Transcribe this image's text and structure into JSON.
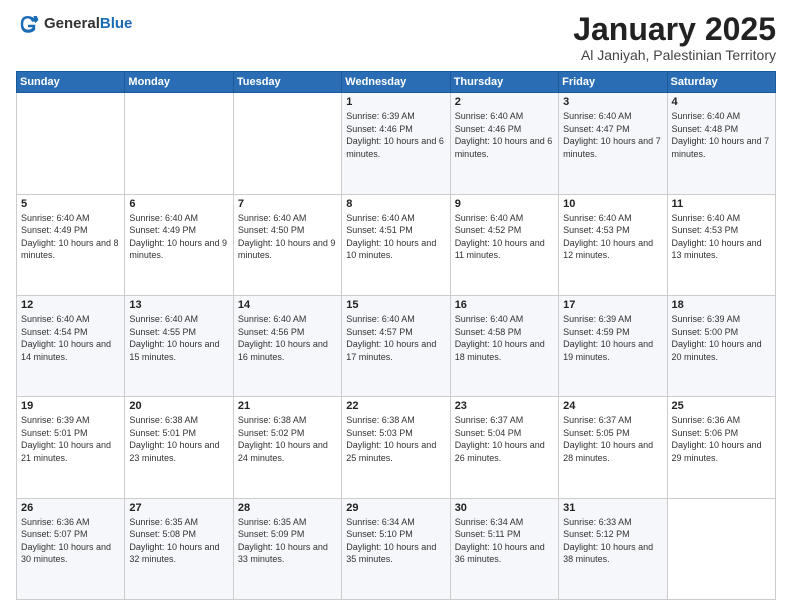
{
  "header": {
    "logo_general": "General",
    "logo_blue": "Blue",
    "title": "January 2025",
    "subtitle": "Al Janiyah, Palestinian Territory"
  },
  "weekdays": [
    "Sunday",
    "Monday",
    "Tuesday",
    "Wednesday",
    "Thursday",
    "Friday",
    "Saturday"
  ],
  "weeks": [
    [
      {
        "day": "",
        "sunrise": "",
        "sunset": "",
        "daylight": ""
      },
      {
        "day": "",
        "sunrise": "",
        "sunset": "",
        "daylight": ""
      },
      {
        "day": "",
        "sunrise": "",
        "sunset": "",
        "daylight": ""
      },
      {
        "day": "1",
        "sunrise": "Sunrise: 6:39 AM",
        "sunset": "Sunset: 4:46 PM",
        "daylight": "Daylight: 10 hours and 6 minutes."
      },
      {
        "day": "2",
        "sunrise": "Sunrise: 6:40 AM",
        "sunset": "Sunset: 4:46 PM",
        "daylight": "Daylight: 10 hours and 6 minutes."
      },
      {
        "day": "3",
        "sunrise": "Sunrise: 6:40 AM",
        "sunset": "Sunset: 4:47 PM",
        "daylight": "Daylight: 10 hours and 7 minutes."
      },
      {
        "day": "4",
        "sunrise": "Sunrise: 6:40 AM",
        "sunset": "Sunset: 4:48 PM",
        "daylight": "Daylight: 10 hours and 7 minutes."
      }
    ],
    [
      {
        "day": "5",
        "sunrise": "Sunrise: 6:40 AM",
        "sunset": "Sunset: 4:49 PM",
        "daylight": "Daylight: 10 hours and 8 minutes."
      },
      {
        "day": "6",
        "sunrise": "Sunrise: 6:40 AM",
        "sunset": "Sunset: 4:49 PM",
        "daylight": "Daylight: 10 hours and 9 minutes."
      },
      {
        "day": "7",
        "sunrise": "Sunrise: 6:40 AM",
        "sunset": "Sunset: 4:50 PM",
        "daylight": "Daylight: 10 hours and 9 minutes."
      },
      {
        "day": "8",
        "sunrise": "Sunrise: 6:40 AM",
        "sunset": "Sunset: 4:51 PM",
        "daylight": "Daylight: 10 hours and 10 minutes."
      },
      {
        "day": "9",
        "sunrise": "Sunrise: 6:40 AM",
        "sunset": "Sunset: 4:52 PM",
        "daylight": "Daylight: 10 hours and 11 minutes."
      },
      {
        "day": "10",
        "sunrise": "Sunrise: 6:40 AM",
        "sunset": "Sunset: 4:53 PM",
        "daylight": "Daylight: 10 hours and 12 minutes."
      },
      {
        "day": "11",
        "sunrise": "Sunrise: 6:40 AM",
        "sunset": "Sunset: 4:53 PM",
        "daylight": "Daylight: 10 hours and 13 minutes."
      }
    ],
    [
      {
        "day": "12",
        "sunrise": "Sunrise: 6:40 AM",
        "sunset": "Sunset: 4:54 PM",
        "daylight": "Daylight: 10 hours and 14 minutes."
      },
      {
        "day": "13",
        "sunrise": "Sunrise: 6:40 AM",
        "sunset": "Sunset: 4:55 PM",
        "daylight": "Daylight: 10 hours and 15 minutes."
      },
      {
        "day": "14",
        "sunrise": "Sunrise: 6:40 AM",
        "sunset": "Sunset: 4:56 PM",
        "daylight": "Daylight: 10 hours and 16 minutes."
      },
      {
        "day": "15",
        "sunrise": "Sunrise: 6:40 AM",
        "sunset": "Sunset: 4:57 PM",
        "daylight": "Daylight: 10 hours and 17 minutes."
      },
      {
        "day": "16",
        "sunrise": "Sunrise: 6:40 AM",
        "sunset": "Sunset: 4:58 PM",
        "daylight": "Daylight: 10 hours and 18 minutes."
      },
      {
        "day": "17",
        "sunrise": "Sunrise: 6:39 AM",
        "sunset": "Sunset: 4:59 PM",
        "daylight": "Daylight: 10 hours and 19 minutes."
      },
      {
        "day": "18",
        "sunrise": "Sunrise: 6:39 AM",
        "sunset": "Sunset: 5:00 PM",
        "daylight": "Daylight: 10 hours and 20 minutes."
      }
    ],
    [
      {
        "day": "19",
        "sunrise": "Sunrise: 6:39 AM",
        "sunset": "Sunset: 5:01 PM",
        "daylight": "Daylight: 10 hours and 21 minutes."
      },
      {
        "day": "20",
        "sunrise": "Sunrise: 6:38 AM",
        "sunset": "Sunset: 5:01 PM",
        "daylight": "Daylight: 10 hours and 23 minutes."
      },
      {
        "day": "21",
        "sunrise": "Sunrise: 6:38 AM",
        "sunset": "Sunset: 5:02 PM",
        "daylight": "Daylight: 10 hours and 24 minutes."
      },
      {
        "day": "22",
        "sunrise": "Sunrise: 6:38 AM",
        "sunset": "Sunset: 5:03 PM",
        "daylight": "Daylight: 10 hours and 25 minutes."
      },
      {
        "day": "23",
        "sunrise": "Sunrise: 6:37 AM",
        "sunset": "Sunset: 5:04 PM",
        "daylight": "Daylight: 10 hours and 26 minutes."
      },
      {
        "day": "24",
        "sunrise": "Sunrise: 6:37 AM",
        "sunset": "Sunset: 5:05 PM",
        "daylight": "Daylight: 10 hours and 28 minutes."
      },
      {
        "day": "25",
        "sunrise": "Sunrise: 6:36 AM",
        "sunset": "Sunset: 5:06 PM",
        "daylight": "Daylight: 10 hours and 29 minutes."
      }
    ],
    [
      {
        "day": "26",
        "sunrise": "Sunrise: 6:36 AM",
        "sunset": "Sunset: 5:07 PM",
        "daylight": "Daylight: 10 hours and 30 minutes."
      },
      {
        "day": "27",
        "sunrise": "Sunrise: 6:35 AM",
        "sunset": "Sunset: 5:08 PM",
        "daylight": "Daylight: 10 hours and 32 minutes."
      },
      {
        "day": "28",
        "sunrise": "Sunrise: 6:35 AM",
        "sunset": "Sunset: 5:09 PM",
        "daylight": "Daylight: 10 hours and 33 minutes."
      },
      {
        "day": "29",
        "sunrise": "Sunrise: 6:34 AM",
        "sunset": "Sunset: 5:10 PM",
        "daylight": "Daylight: 10 hours and 35 minutes."
      },
      {
        "day": "30",
        "sunrise": "Sunrise: 6:34 AM",
        "sunset": "Sunset: 5:11 PM",
        "daylight": "Daylight: 10 hours and 36 minutes."
      },
      {
        "day": "31",
        "sunrise": "Sunrise: 6:33 AM",
        "sunset": "Sunset: 5:12 PM",
        "daylight": "Daylight: 10 hours and 38 minutes."
      },
      {
        "day": "",
        "sunrise": "",
        "sunset": "",
        "daylight": ""
      }
    ]
  ]
}
